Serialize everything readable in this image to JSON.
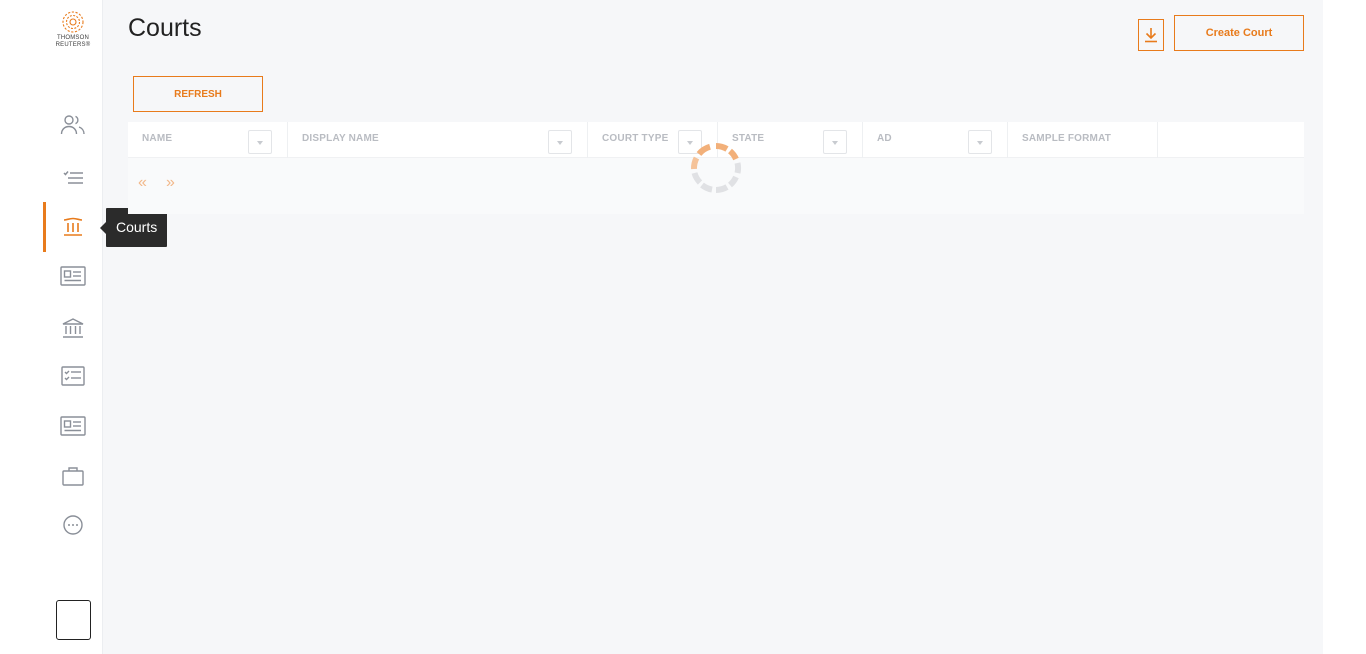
{
  "logo": {
    "text": "THOMSON\nREUTERS®"
  },
  "sidebar": {
    "items": [
      {
        "name": "users",
        "icon": "users-icon",
        "active": false
      },
      {
        "name": "tasks",
        "icon": "checklist-icon",
        "active": false
      },
      {
        "name": "courts",
        "icon": "court-icon",
        "active": true
      },
      {
        "name": "id-cards",
        "icon": "id-card-icon",
        "active": false
      },
      {
        "name": "institutions",
        "icon": "bank-icon",
        "active": false
      },
      {
        "name": "checklists",
        "icon": "check-list-icon",
        "active": false
      },
      {
        "name": "profiles",
        "icon": "profile-card-icon",
        "active": false
      },
      {
        "name": "cases",
        "icon": "briefcase-icon",
        "active": false
      },
      {
        "name": "more",
        "icon": "more-icon",
        "active": false
      }
    ]
  },
  "tooltip": {
    "label": "Courts"
  },
  "header": {
    "title": "Courts",
    "create_label": "Create Court",
    "download_icon": "download-icon"
  },
  "toolbar": {
    "refresh_label": "REFRESH"
  },
  "grid": {
    "columns": [
      {
        "label": "NAME",
        "filter": true
      },
      {
        "label": "DISPLAY NAME",
        "filter": true
      },
      {
        "label": "COURT TYPE",
        "filter": true
      },
      {
        "label": "STATE",
        "filter": true
      },
      {
        "label": "AD",
        "filter": true
      },
      {
        "label": "SAMPLE FORMAT",
        "filter": false
      }
    ],
    "pager": {
      "prev": "«",
      "next": "»"
    },
    "loading": true
  },
  "colors": {
    "accent": "#e87b1c",
    "background": "#f6f7f9"
  }
}
